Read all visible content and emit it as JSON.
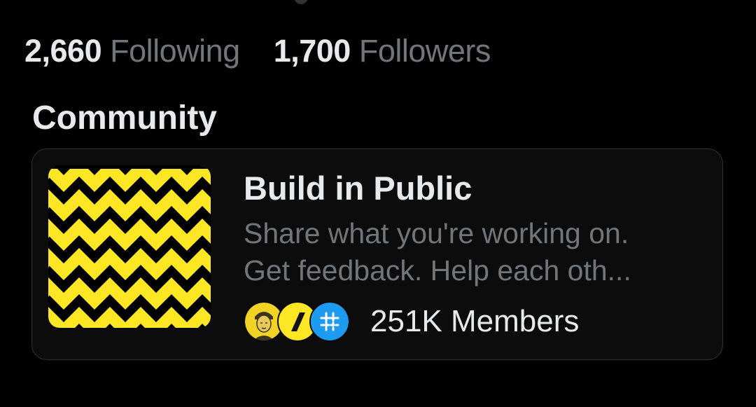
{
  "profile": {
    "following_count": "2,660",
    "following_label": "Following",
    "followers_count": "1,700",
    "followers_label": "Followers"
  },
  "community_section": {
    "heading": "Community",
    "community": {
      "name": "Build in Public",
      "description_line1": "Share what you're working on.",
      "description_line2": "Get feedback. Help each oth...",
      "members_label": "251K Members",
      "banner_icon": "zigzag-pattern",
      "member_avatars": [
        "member-avatar-illustrated-person",
        "member-avatar-slash-logo",
        "member-avatar-hashtag-logo"
      ]
    }
  },
  "colors": {
    "background": "#000000",
    "card_background": "#0c0c0c",
    "card_border": "#2f3336",
    "primary_text": "#e7e9ea",
    "secondary_text": "#71767b",
    "banner_yellow": "#fde724",
    "avatar_blue": "#1d9bf0"
  }
}
